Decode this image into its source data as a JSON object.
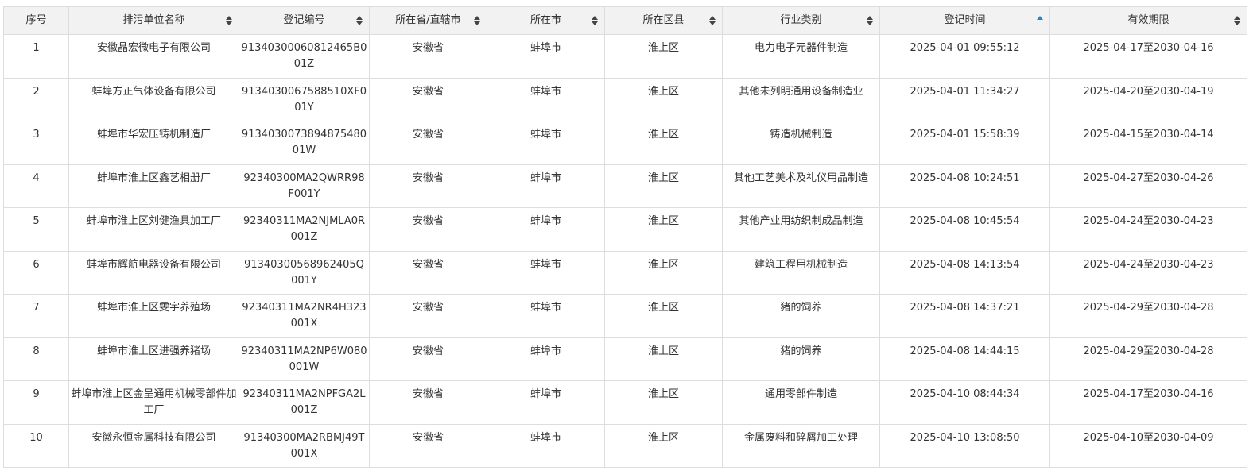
{
  "table": {
    "columns": [
      {
        "label": "序号",
        "sortable": false
      },
      {
        "label": "排污单位名称",
        "sortable": true
      },
      {
        "label": "登记编号",
        "sortable": true
      },
      {
        "label": "所在省/直辖市",
        "sortable": true
      },
      {
        "label": "所在市",
        "sortable": true
      },
      {
        "label": "所在区县",
        "sortable": true
      },
      {
        "label": "行业类别",
        "sortable": true
      },
      {
        "label": "登记时间",
        "sortable": true,
        "active_sort": "ascending"
      },
      {
        "label": "有效期限",
        "sortable": true
      }
    ],
    "active_sort_color": "#1e88d4",
    "rows": [
      [
        "1",
        "安徽晶宏微电子有限公司",
        "91340300060812465B001Z",
        "安徽省",
        "蚌埠市",
        "淮上区",
        "电力电子元器件制造",
        "2025-04-01 09:55:12",
        "2025-04-17至2030-04-16"
      ],
      [
        "2",
        "蚌埠方正气体设备有限公司",
        "9134030067588510XF001Y",
        "安徽省",
        "蚌埠市",
        "淮上区",
        "其他未列明通用设备制造业",
        "2025-04-01 11:34:27",
        "2025-04-20至2030-04-19"
      ],
      [
        "3",
        "蚌埠市华宏压铸机制造厂",
        "913403007389487548001W",
        "安徽省",
        "蚌埠市",
        "淮上区",
        "铸造机械制造",
        "2025-04-01 15:58:39",
        "2025-04-15至2030-04-14"
      ],
      [
        "4",
        "蚌埠市淮上区鑫艺相册厂",
        "92340300MA2QWRR98F001Y",
        "安徽省",
        "蚌埠市",
        "淮上区",
        "其他工艺美术及礼仪用品制造",
        "2025-04-08 10:24:51",
        "2025-04-27至2030-04-26"
      ],
      [
        "5",
        "蚌埠市淮上区刘健渔具加工厂",
        "92340311MA2NJMLA0R001Z",
        "安徽省",
        "蚌埠市",
        "淮上区",
        "其他产业用纺织制成品制造",
        "2025-04-08 10:45:54",
        "2025-04-24至2030-04-23"
      ],
      [
        "6",
        "蚌埠市辉航电器设备有限公司",
        "91340300568962405Q001Y",
        "安徽省",
        "蚌埠市",
        "淮上区",
        "建筑工程用机械制造",
        "2025-04-08 14:13:54",
        "2025-04-24至2030-04-23"
      ],
      [
        "7",
        "蚌埠市淮上区雯宇养殖场",
        "92340311MA2NR4H323001X",
        "安徽省",
        "蚌埠市",
        "淮上区",
        "猪的饲养",
        "2025-04-08 14:37:21",
        "2025-04-29至2030-04-28"
      ],
      [
        "8",
        "蚌埠市淮上区进强养猪场",
        "92340311MA2NP6W080001W",
        "安徽省",
        "蚌埠市",
        "淮上区",
        "猪的饲养",
        "2025-04-08 14:44:15",
        "2025-04-29至2030-04-28"
      ],
      [
        "9",
        "蚌埠市淮上区金呈通用机械零部件加工厂",
        "92340311MA2NPFGA2L001Z",
        "安徽省",
        "蚌埠市",
        "淮上区",
        "通用零部件制造",
        "2025-04-10 08:44:34",
        "2025-04-17至2030-04-16"
      ],
      [
        "10",
        "安徽永恒金属科技有限公司",
        "91340300MA2RBMJ49T001X",
        "安徽省",
        "蚌埠市",
        "淮上区",
        "金属废料和碎屑加工处理",
        "2025-04-10 13:08:50",
        "2025-04-10至2030-04-09"
      ]
    ]
  }
}
